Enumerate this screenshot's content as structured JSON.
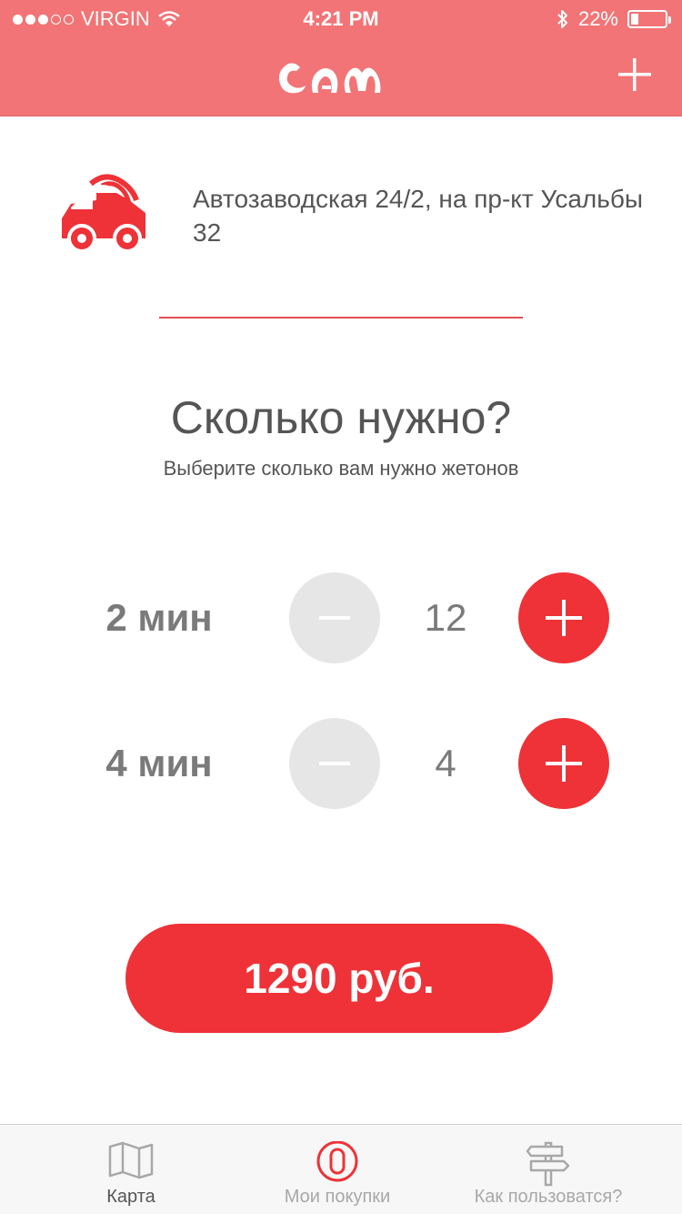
{
  "status_bar": {
    "carrier": "VIRGIN",
    "time": "4:21 PM",
    "battery": "22%",
    "battery_level": 0.22,
    "signal_bars_filled": 3,
    "signal_bars_total": 5
  },
  "header": {
    "logo_text": "cam",
    "add_icon": "plus-icon",
    "background_color": "#f27476"
  },
  "location": {
    "icon": "car-wash-icon",
    "address": "Автозаводская 24/2, на пр-кт Усальбы 32"
  },
  "selection": {
    "title": "Сколько нужно?",
    "subtitle": "Выберите сколько вам нужно жетонов"
  },
  "tokens": [
    {
      "label": "2 мин",
      "count": "12"
    },
    {
      "label": "4 мин",
      "count": "4"
    }
  ],
  "purchase": {
    "price_label": "1290 руб."
  },
  "tabbar": {
    "items": [
      {
        "label": "Карта",
        "icon": "map-icon",
        "active": true
      },
      {
        "label": "Мои покупки",
        "icon": "token-icon",
        "active": false
      },
      {
        "label": "Как пользоватся?",
        "icon": "signpost-icon",
        "active": false
      }
    ]
  },
  "colors": {
    "accent": "#ee3238",
    "header": "#f27476",
    "minus_button": "#e6e6e6"
  }
}
